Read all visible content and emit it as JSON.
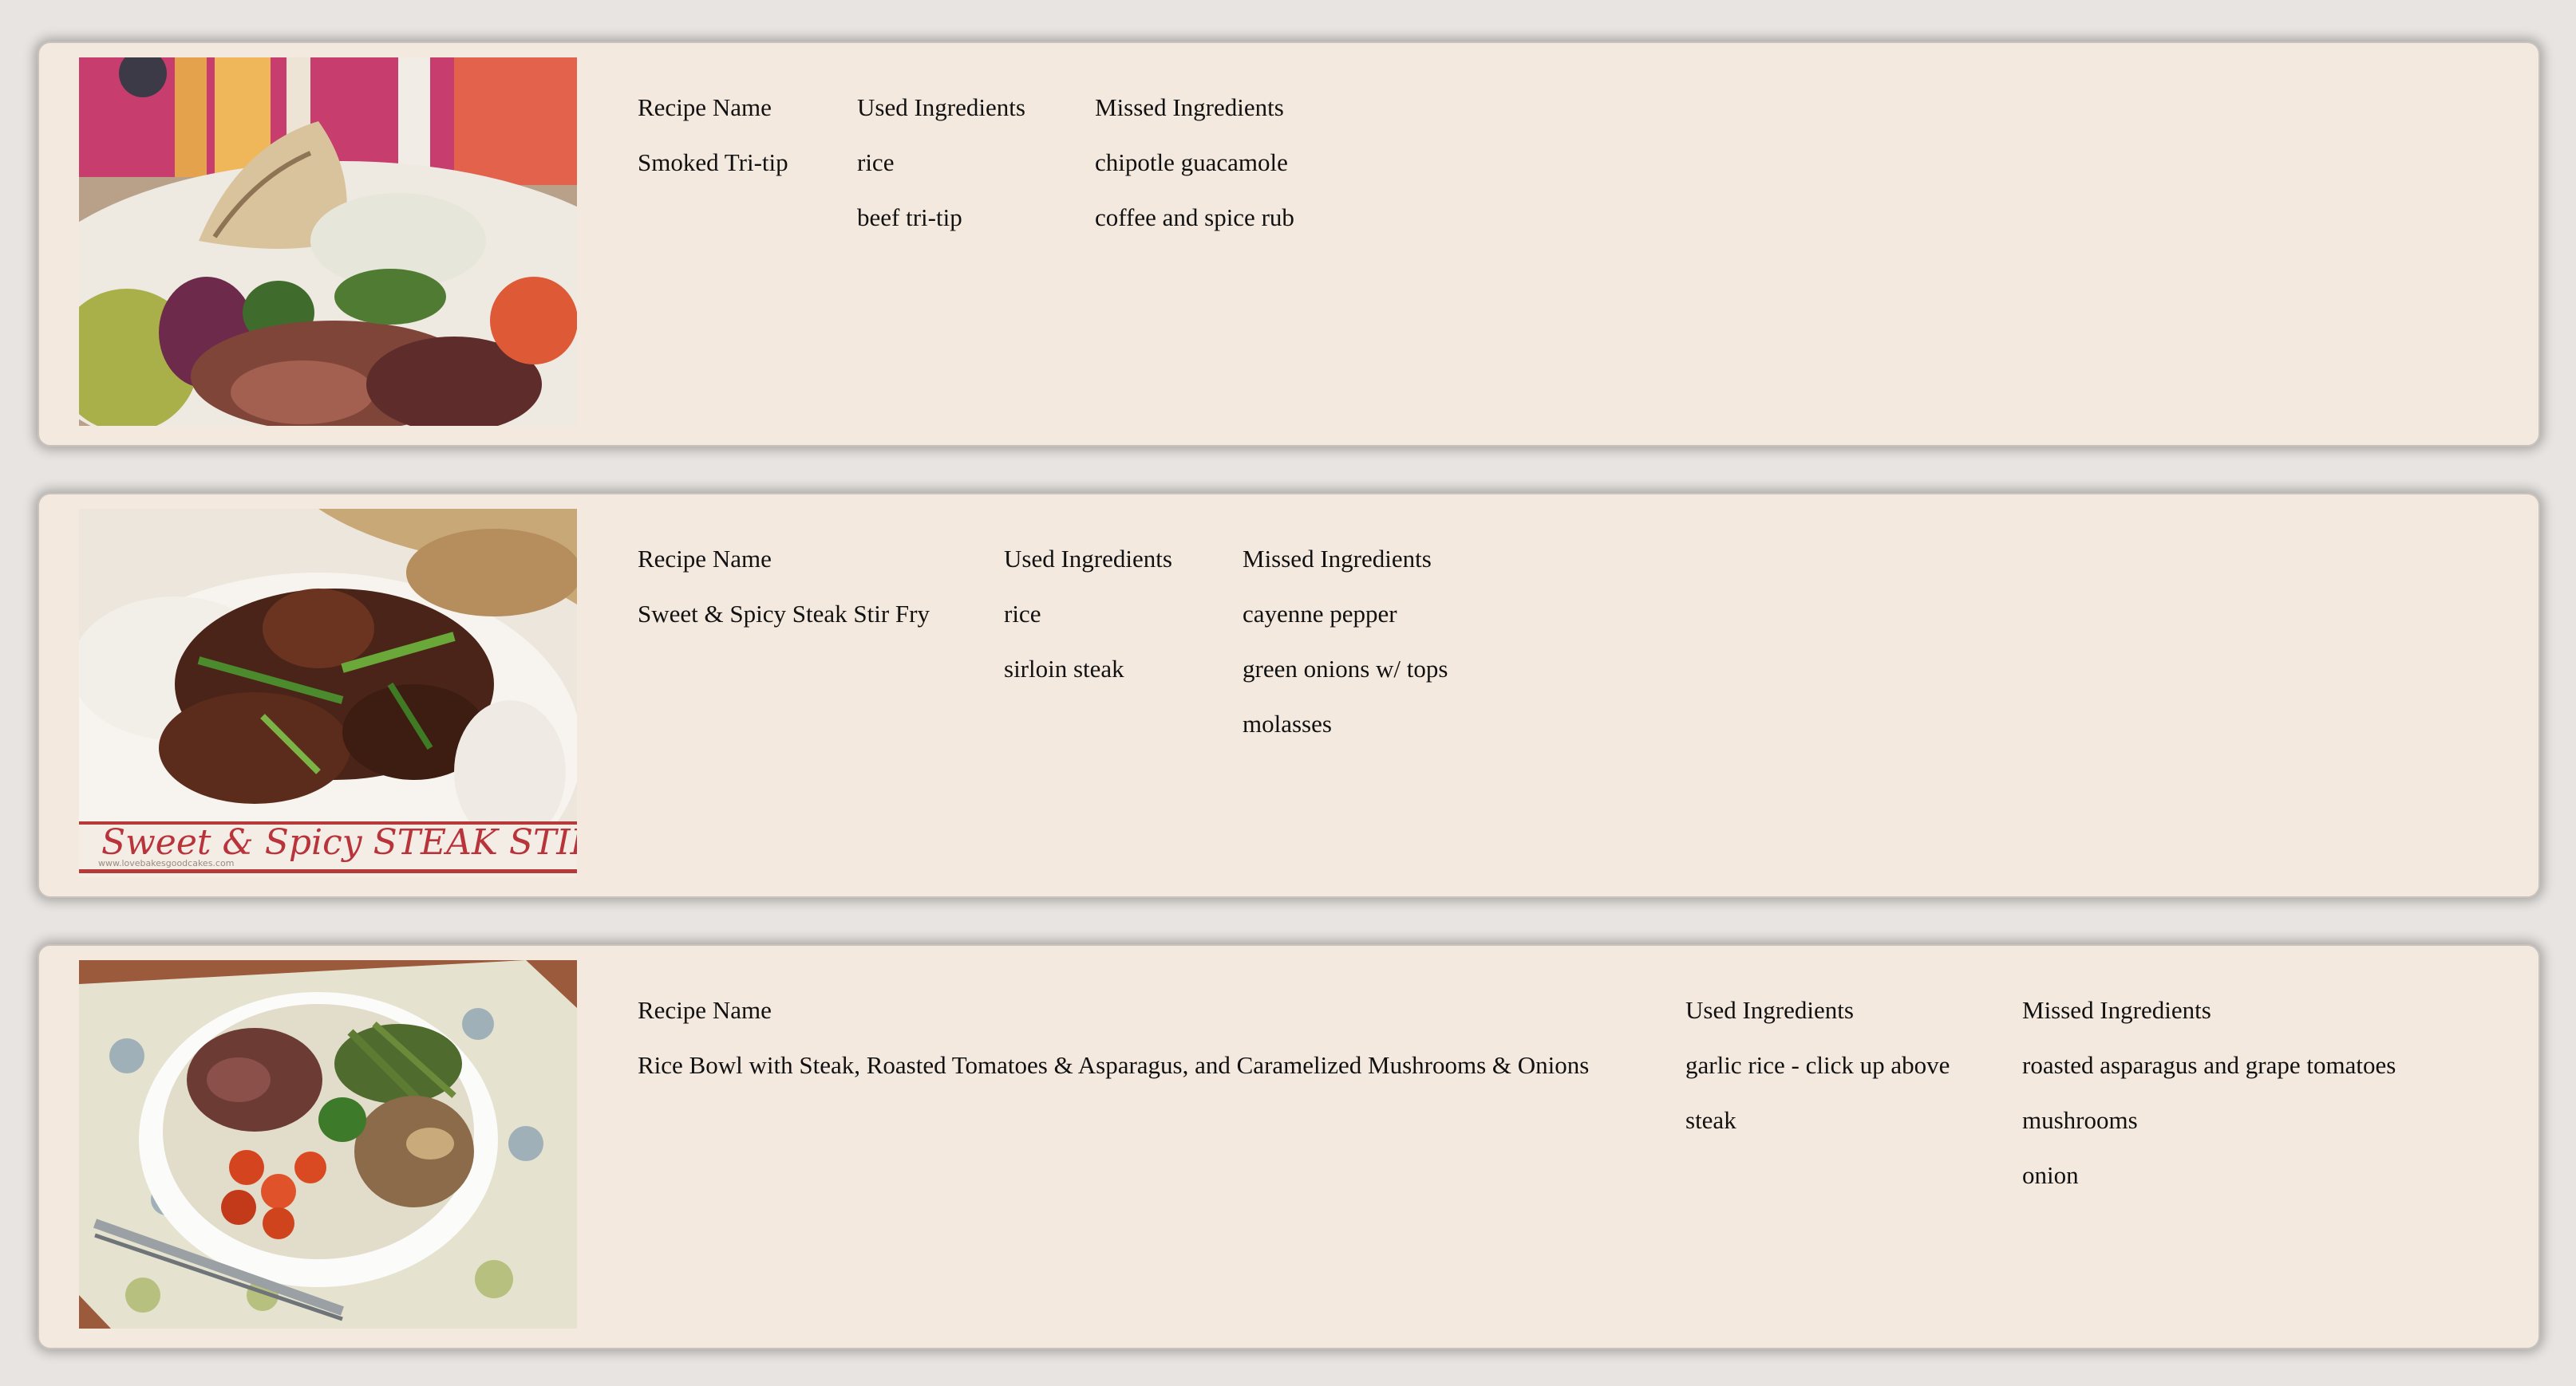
{
  "columns": {
    "recipe_name": "Recipe Name",
    "used": "Used Ingredients",
    "missed": "Missed Ingredients"
  },
  "recipes": [
    {
      "name": "Smoked Tri-tip",
      "image": "smoked-tri-tip-photo",
      "used": [
        "rice",
        "beef tri-tip"
      ],
      "missed": [
        "chipotle guacamole",
        "coffee and spice rub"
      ]
    },
    {
      "name": "Sweet & Spicy Steak Stir Fry",
      "image": "steak-stir-fry-photo",
      "image_caption": "Sweet & Spicy STEAK STIR FRY",
      "image_watermark": "www.lovebakesgoodcakes.com",
      "used": [
        "rice",
        "sirloin steak"
      ],
      "missed": [
        "cayenne pepper",
        "green onions w/ tops",
        "molasses"
      ]
    },
    {
      "name": "Rice Bowl with Steak, Roasted Tomatoes & Asparagus, and Caramelized Mushrooms & Onions",
      "image": "rice-bowl-photo",
      "used": [
        "garlic rice - click up above",
        "steak"
      ],
      "missed": [
        "roasted asparagus and grape tomatoes",
        "mushrooms",
        "onion"
      ]
    }
  ],
  "colors": {
    "page_background": "#e7e4e1",
    "card_background": "#f4e9df",
    "text": "#111111"
  }
}
